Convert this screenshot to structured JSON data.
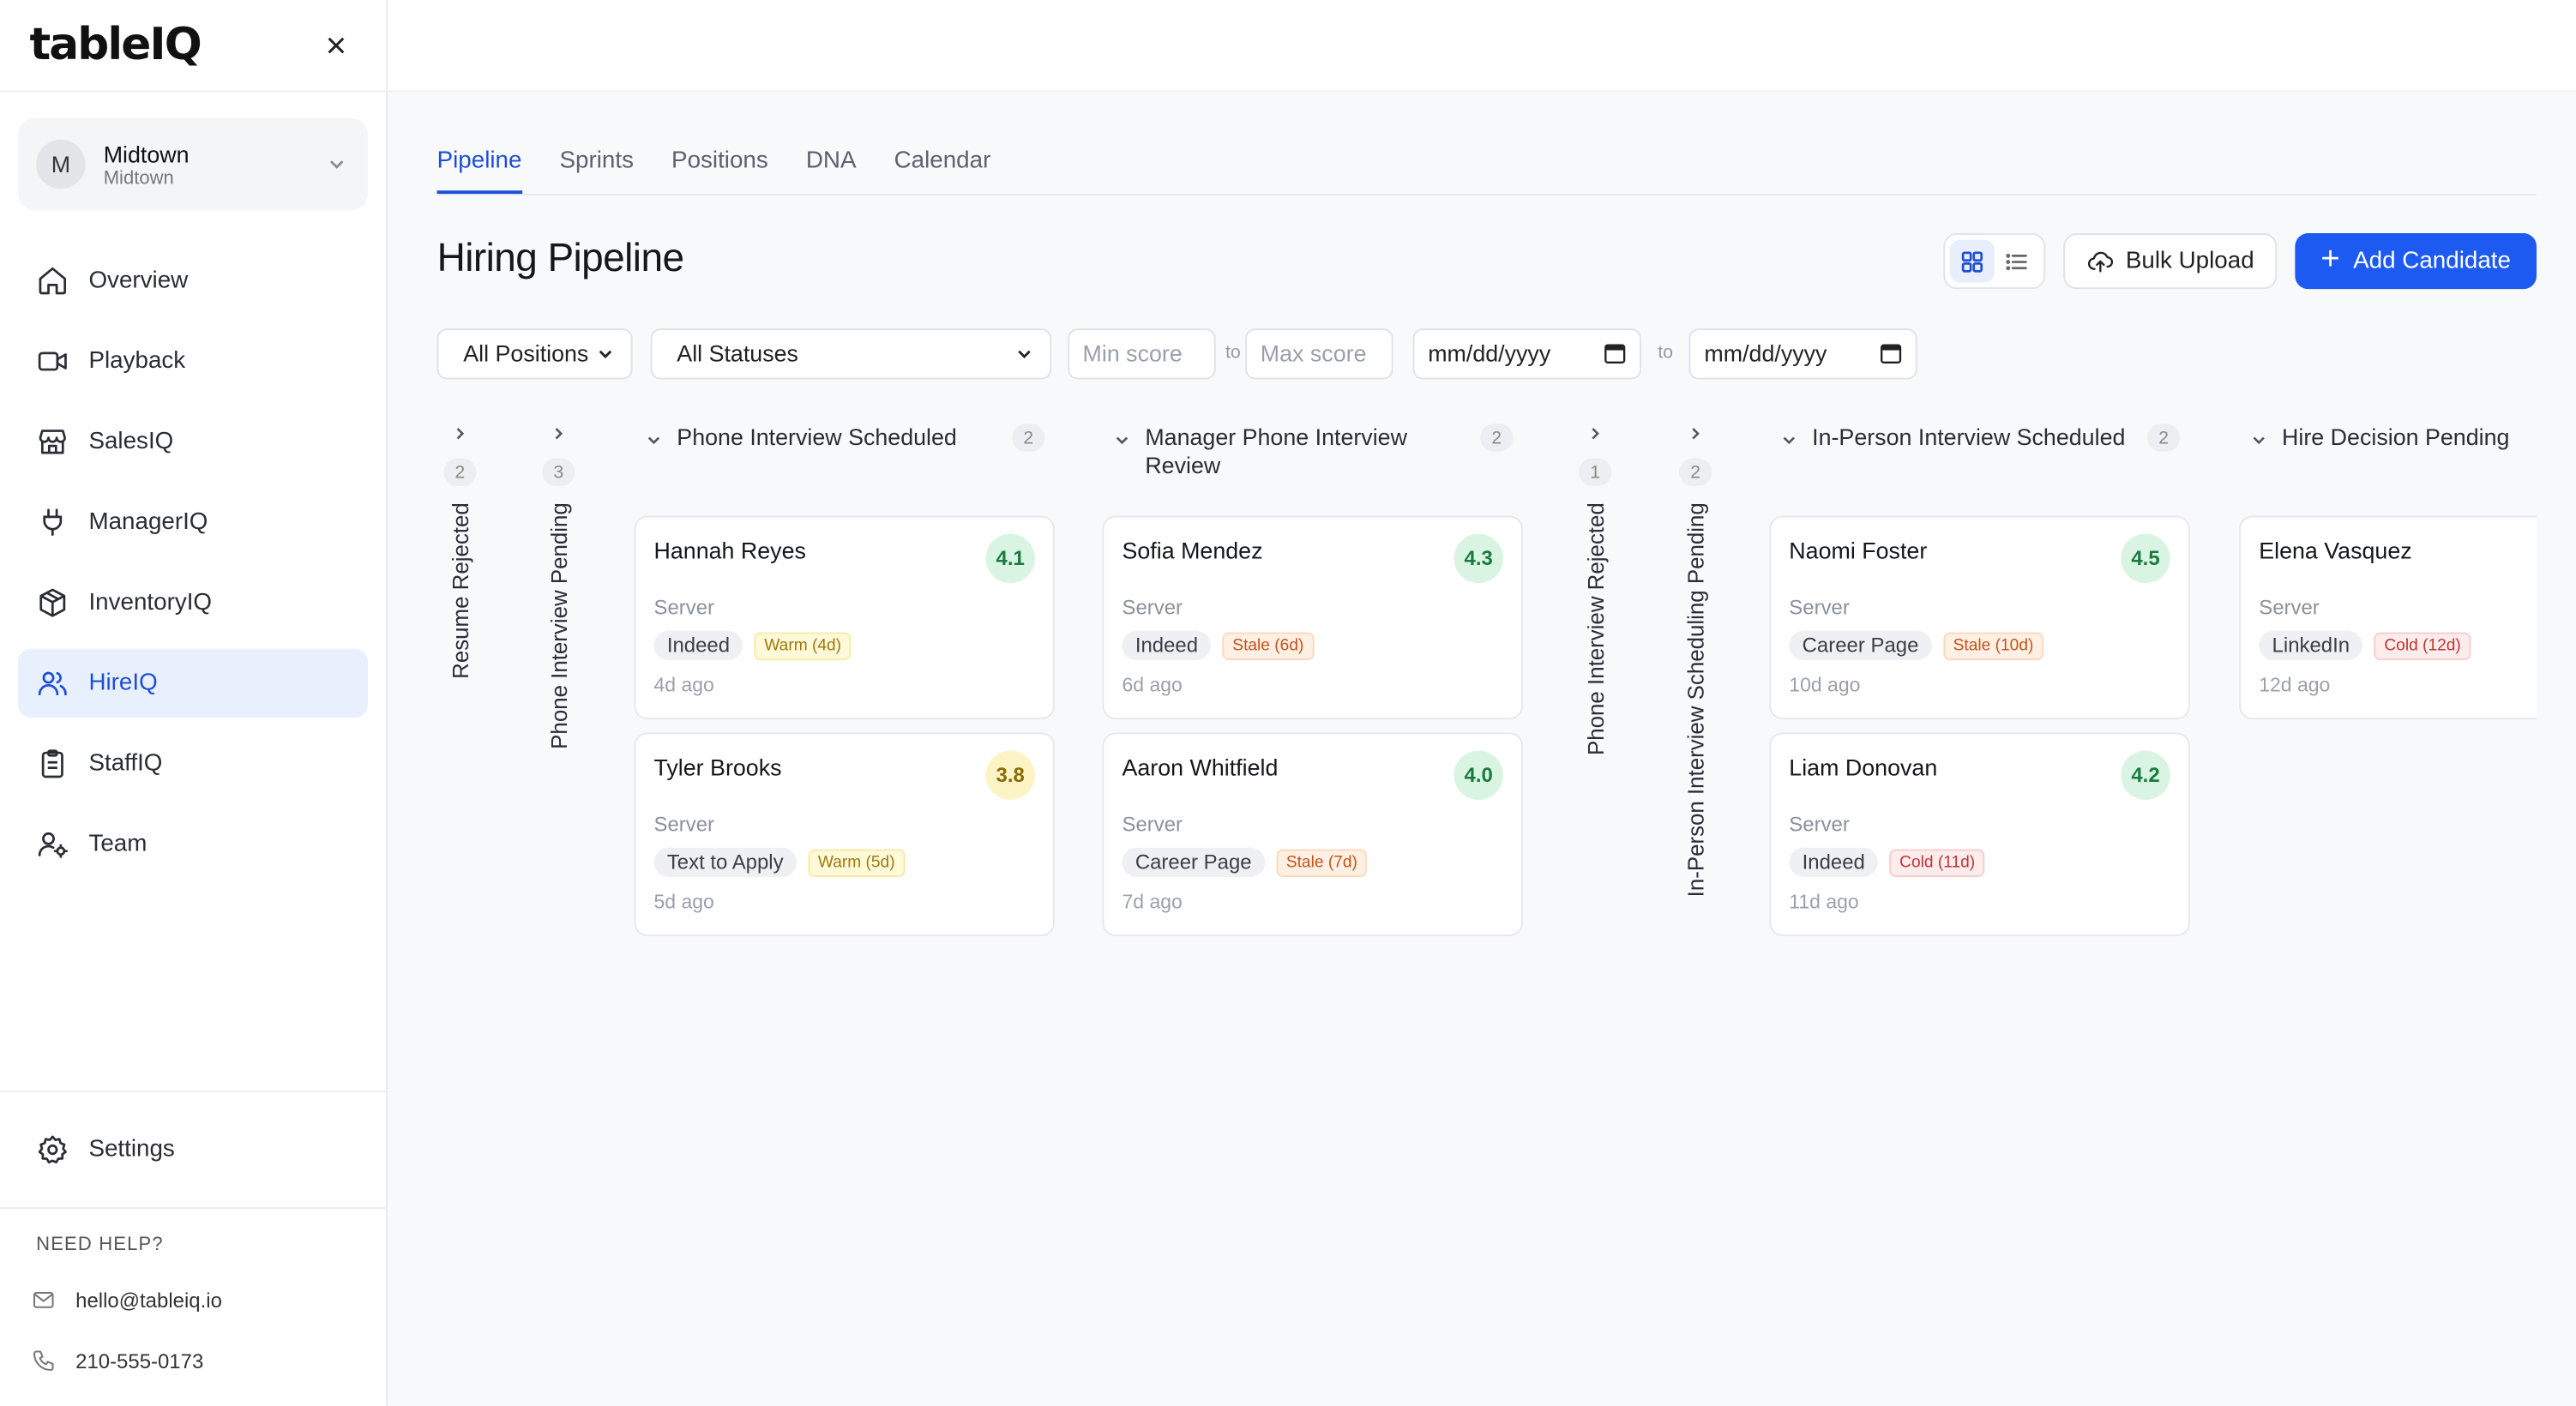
{
  "brand": {
    "logo": "tableIQ",
    "close": "×"
  },
  "org": {
    "avatar": "M",
    "name": "Midtown",
    "sub": "Midtown"
  },
  "nav": [
    {
      "label": "Overview",
      "icon": "home-icon"
    },
    {
      "label": "Playback",
      "icon": "video-icon"
    },
    {
      "label": "SalesIQ",
      "icon": "store-icon"
    },
    {
      "label": "ManagerIQ",
      "icon": "plug-icon"
    },
    {
      "label": "InventoryIQ",
      "icon": "box-icon"
    },
    {
      "label": "HireIQ",
      "icon": "users-icon",
      "active": true
    },
    {
      "label": "StaffIQ",
      "icon": "clipboard-icon"
    },
    {
      "label": "Team",
      "icon": "user-gear-icon"
    }
  ],
  "settings": {
    "label": "Settings"
  },
  "help": {
    "title": "NEED HELP?",
    "email": "hello@tableiq.io",
    "phone": "210-555-0173"
  },
  "tabs": [
    {
      "label": "Pipeline",
      "active": true
    },
    {
      "label": "Sprints"
    },
    {
      "label": "Positions"
    },
    {
      "label": "DNA"
    },
    {
      "label": "Calendar"
    }
  ],
  "page": {
    "title": "Hiring Pipeline"
  },
  "actions": {
    "bulk_upload": "Bulk Upload",
    "add_candidate": "Add Candidate",
    "plus": "+"
  },
  "filters": {
    "positions": "All Positions",
    "statuses": "All Statuses",
    "min_score": "Min score",
    "max_score": "Max score",
    "to": "to",
    "date_from": "mm/dd/yyyy",
    "date_to": "mm/dd/yyyy"
  },
  "colors": {
    "accent": "#1d5af2",
    "active_nav_bg": "#e9f0fd"
  },
  "board": {
    "collapsed": [
      {
        "title": "Resume Rejected",
        "count": "2"
      },
      {
        "title": "Phone Interview Pending",
        "count": "3"
      },
      {
        "title": "Phone Interview Rejected",
        "count": "1"
      },
      {
        "title": "In-Person Interview Scheduling Pending",
        "count": "2"
      }
    ],
    "columns": [
      {
        "title": "Phone Interview Scheduled",
        "count": "2",
        "cards": [
          {
            "name": "Hannah Reyes",
            "score": "4.1",
            "score_tone": "green",
            "role": "Server",
            "source": "Indeed",
            "freshness": "Warm (4d)",
            "tone": "warm",
            "ago": "4d ago"
          },
          {
            "name": "Tyler Brooks",
            "score": "3.8",
            "score_tone": "yellow",
            "role": "Server",
            "source": "Text to Apply",
            "freshness": "Warm (5d)",
            "tone": "warm",
            "ago": "5d ago"
          }
        ]
      },
      {
        "title": "Manager Phone Interview Review",
        "count": "2",
        "cards": [
          {
            "name": "Sofia Mendez",
            "score": "4.3",
            "score_tone": "green",
            "role": "Server",
            "source": "Indeed",
            "freshness": "Stale (6d)",
            "tone": "stale",
            "ago": "6d ago"
          },
          {
            "name": "Aaron Whitfield",
            "score": "4.0",
            "score_tone": "green",
            "role": "Server",
            "source": "Career Page",
            "freshness": "Stale (7d)",
            "tone": "stale",
            "ago": "7d ago"
          }
        ]
      },
      {
        "title": "In-Person Interview Scheduled",
        "count": "2",
        "cards": [
          {
            "name": "Naomi Foster",
            "score": "4.5",
            "score_tone": "green",
            "role": "Server",
            "source": "Career Page",
            "freshness": "Stale (10d)",
            "tone": "stale",
            "ago": "10d ago"
          },
          {
            "name": "Liam Donovan",
            "score": "4.2",
            "score_tone": "green",
            "role": "Server",
            "source": "Indeed",
            "freshness": "Cold (11d)",
            "tone": "cold",
            "ago": "11d ago"
          }
        ]
      },
      {
        "title": "Hire Decision Pending",
        "count": "",
        "cards": [
          {
            "name": "Elena Vasquez",
            "score": "",
            "score_tone": "green",
            "role": "Server",
            "source": "LinkedIn",
            "freshness": "Cold (12d)",
            "tone": "cold",
            "ago": "12d ago"
          }
        ]
      }
    ]
  }
}
